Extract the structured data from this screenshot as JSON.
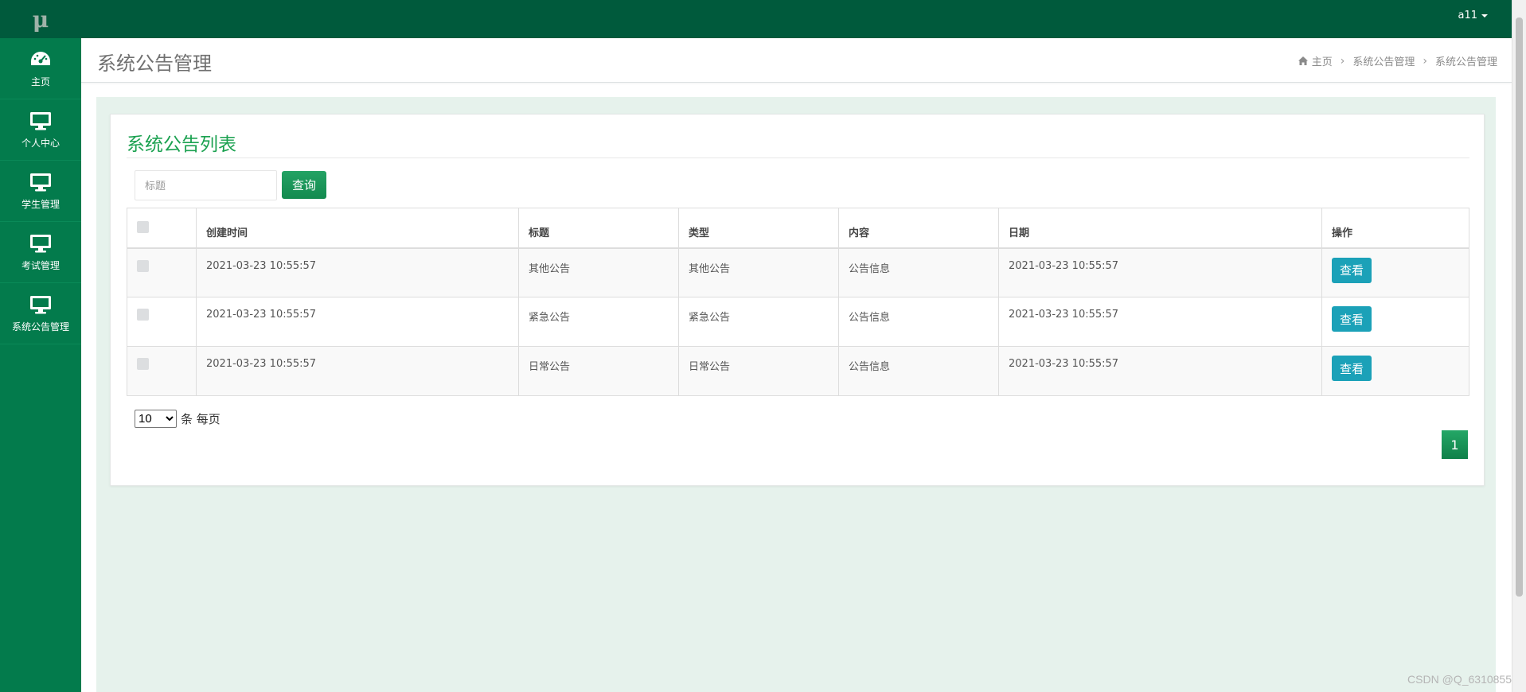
{
  "app": {
    "logo_text": "μ"
  },
  "colors": {
    "primary": "#037b4c",
    "topbar": "#005a3c",
    "accent": "#1ba150",
    "view_button": "#1ba1b8",
    "content_bg": "#e6f2ec"
  },
  "sidebar": {
    "items": [
      {
        "label": "主页",
        "icon": "dashboard-icon"
      },
      {
        "label": "个人中心",
        "icon": "monitor-icon"
      },
      {
        "label": "学生管理",
        "icon": "monitor-icon"
      },
      {
        "label": "考试管理",
        "icon": "monitor-icon"
      },
      {
        "label": "系统公告管理",
        "icon": "monitor-icon"
      }
    ]
  },
  "topbar": {
    "user": "a11"
  },
  "header": {
    "title": "系统公告管理",
    "breadcrumb": [
      "主页",
      "系统公告管理",
      "系统公告管理"
    ]
  },
  "panel": {
    "title": "系统公告列表",
    "search": {
      "placeholder": "标题",
      "value": "",
      "button": "查询"
    },
    "table": {
      "headers": {
        "created": "创建时间",
        "title": "标题",
        "type": "类型",
        "content": "内容",
        "date": "日期",
        "actions": "操作"
      },
      "rows": [
        {
          "created": "2021-03-23 10:55:57",
          "title": "其他公告",
          "type": "其他公告",
          "content": "公告信息",
          "date": "2021-03-23 10:55:57",
          "action": "查看"
        },
        {
          "created": "2021-03-23 10:55:57",
          "title": "紧急公告",
          "type": "紧急公告",
          "content": "公告信息",
          "date": "2021-03-23 10:55:57",
          "action": "查看"
        },
        {
          "created": "2021-03-23 10:55:57",
          "title": "日常公告",
          "type": "日常公告",
          "content": "公告信息",
          "date": "2021-03-23 10:55:57",
          "action": "查看"
        }
      ]
    },
    "pagination": {
      "page_size": "10",
      "page_size_options": [
        "10"
      ],
      "page_size_suffix": "条 每页",
      "current_page": "1"
    }
  },
  "watermark": "CSDN @Q_6310855"
}
